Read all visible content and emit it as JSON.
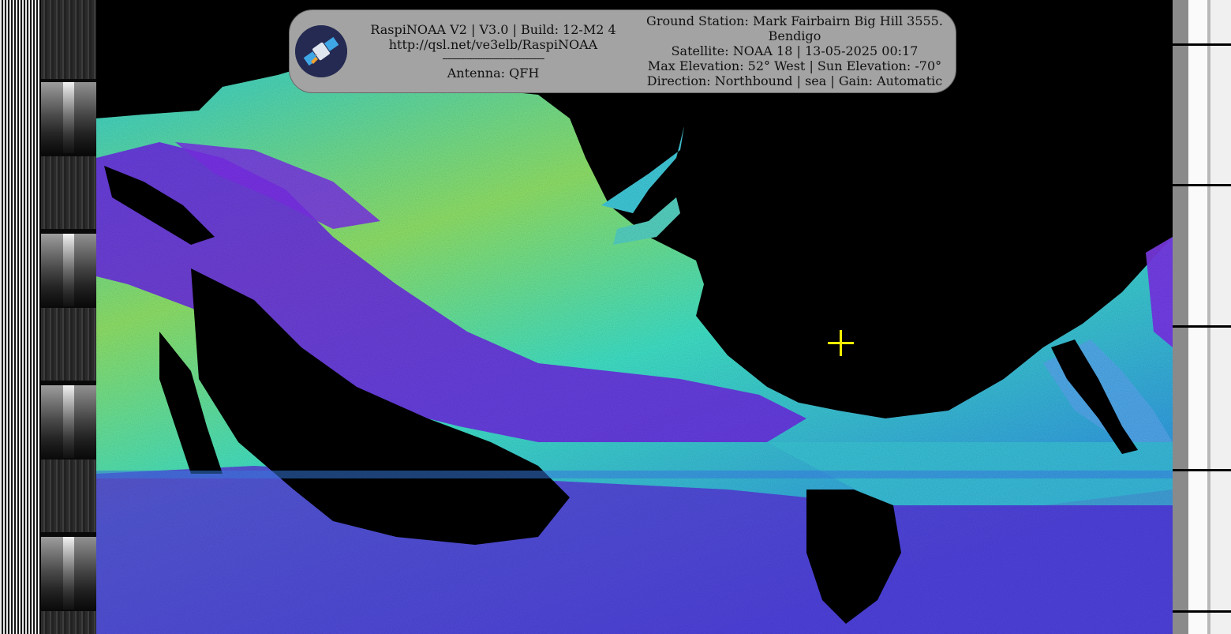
{
  "header": {
    "software": "RaspiNOAA V2 | V3.0 | Build: 12-M2 4",
    "url": "http://qsl.net/ve3elb/RaspiNOAA",
    "divider": "--------------------------------------",
    "antenna": "Antenna: QFH"
  },
  "pass_info": {
    "ground_station": "Ground Station: Mark Fairbairn Big Hill 3555.",
    "location": "Bendigo",
    "satellite": "Satellite: NOAA 18 | 13-05-2025 00:17",
    "elevation": "Max Elevation: 52° West | Sun Elevation: -70°",
    "direction": "Direction: Northbound | sea | Gain: Automatic"
  },
  "icons": {
    "logo": "satellite-logo-icon",
    "marker": "crosshair-icon"
  },
  "colors": {
    "overlay_bg": "#a3a3a3",
    "crosshair": "#ffef00",
    "sea_land_palette": [
      "#5b1fd6",
      "#7b2fe8",
      "#2f6ee6",
      "#27c8d8",
      "#3ee0c8",
      "#8ee060",
      "#d8e83a"
    ]
  }
}
